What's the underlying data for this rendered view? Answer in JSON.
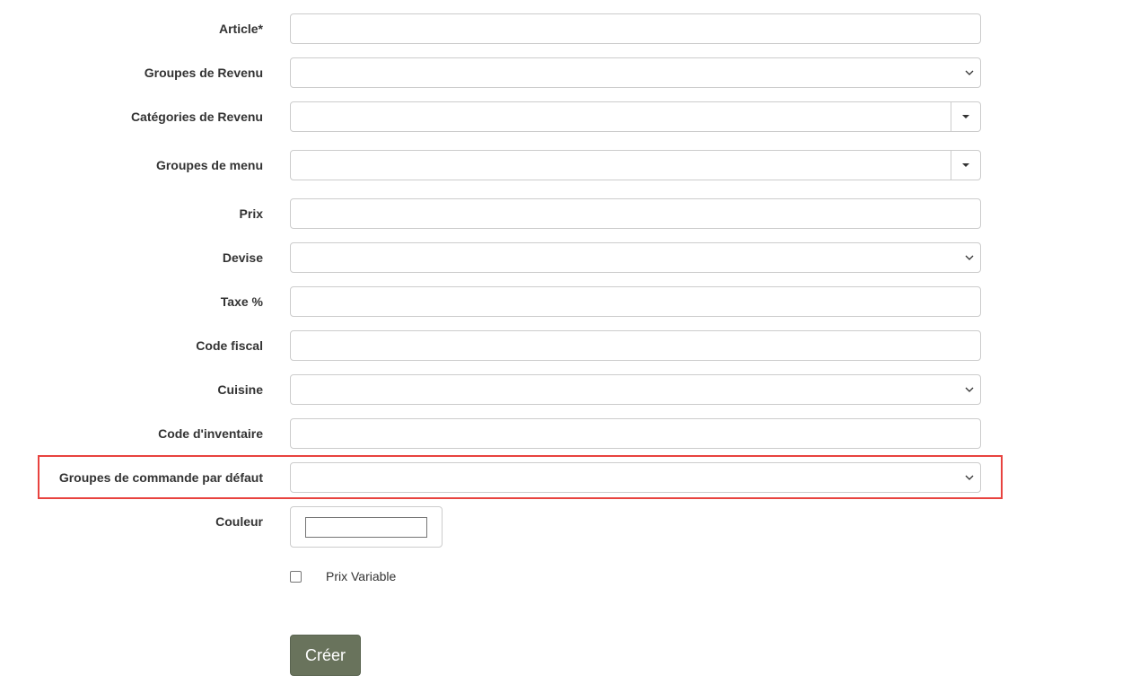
{
  "form": {
    "fields": {
      "article": {
        "label": "Article*",
        "value": ""
      },
      "groupes_revenu": {
        "label": "Groupes de Revenu",
        "value": ""
      },
      "categories_revenu": {
        "label": "Catégories de Revenu",
        "value": ""
      },
      "groupes_menu": {
        "label": "Groupes de menu",
        "value": ""
      },
      "prix": {
        "label": "Prix",
        "value": ""
      },
      "devise": {
        "label": "Devise",
        "value": ""
      },
      "taxe": {
        "label": "Taxe %",
        "value": ""
      },
      "code_fiscal": {
        "label": "Code fiscal",
        "value": ""
      },
      "cuisine": {
        "label": "Cuisine",
        "value": ""
      },
      "code_inventaire": {
        "label": "Code d'inventaire",
        "value": ""
      },
      "groupes_commande": {
        "label": "Groupes de commande par défaut",
        "value": ""
      },
      "couleur": {
        "label": "Couleur",
        "value": "#ffffff"
      },
      "prix_variable": {
        "label": "Prix Variable",
        "checked": false
      }
    },
    "submit_label": "Créer"
  },
  "colors": {
    "highlight": "#e8433f",
    "button_bg": "#69735c",
    "border": "#cccccc"
  },
  "icons": {
    "select": "chevron-down-icon",
    "dropdown": "caret-down-icon"
  }
}
